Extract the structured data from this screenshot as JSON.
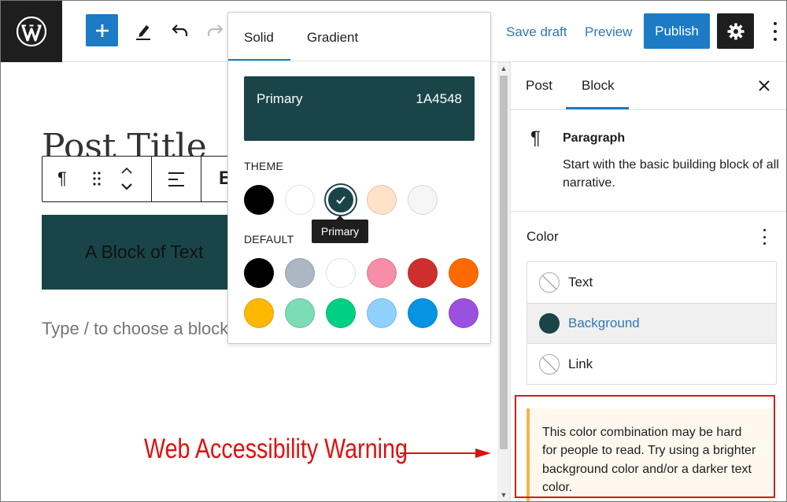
{
  "toolbar": {
    "save_draft": "Save draft",
    "preview": "Preview",
    "publish": "Publish"
  },
  "editor": {
    "post_title": "Post Title",
    "block_text": "A Block of Text",
    "placeholder": "Type / to choose a block"
  },
  "block_toolbar": {
    "bold_glyph": "B"
  },
  "popover": {
    "tabs": [
      "Solid",
      "Gradient"
    ],
    "active_tab": "Solid",
    "selected_name": "Primary",
    "selected_hex": "1A4548",
    "theme_label": "THEME",
    "default_label": "DEFAULT",
    "tooltip": "Primary",
    "theme_colors": [
      "#000000",
      "#ffffff",
      "#1a4548",
      "#ffe2c7",
      "#f6f6f6"
    ],
    "default_colors": [
      "#000000",
      "#abb8c3",
      "#ffffff",
      "#f78da7",
      "#cf2e2e",
      "#ff6900",
      "#fcb900",
      "#7bdcb5",
      "#00d084",
      "#8ed1fc",
      "#0693e3",
      "#9b51e0"
    ]
  },
  "sidebar": {
    "tabs": [
      "Post",
      "Block"
    ],
    "active_tab": "Block",
    "block_name": "Paragraph",
    "block_description": "Start with the basic building block of all narrative.",
    "color_panel_title": "Color",
    "color_items": [
      {
        "label": "Text"
      },
      {
        "label": "Background"
      },
      {
        "label": "Link"
      }
    ],
    "warning": "This color combination may be hard for people to read. Try using a brighter background color and/or a darker text color."
  },
  "annotation": {
    "text": "Web Accessibility Warning"
  },
  "colors": {
    "accent": "#1c7bc4",
    "primary": "#1a4548",
    "warning_border": "#f0b849",
    "annotation_red": "#e01010"
  }
}
